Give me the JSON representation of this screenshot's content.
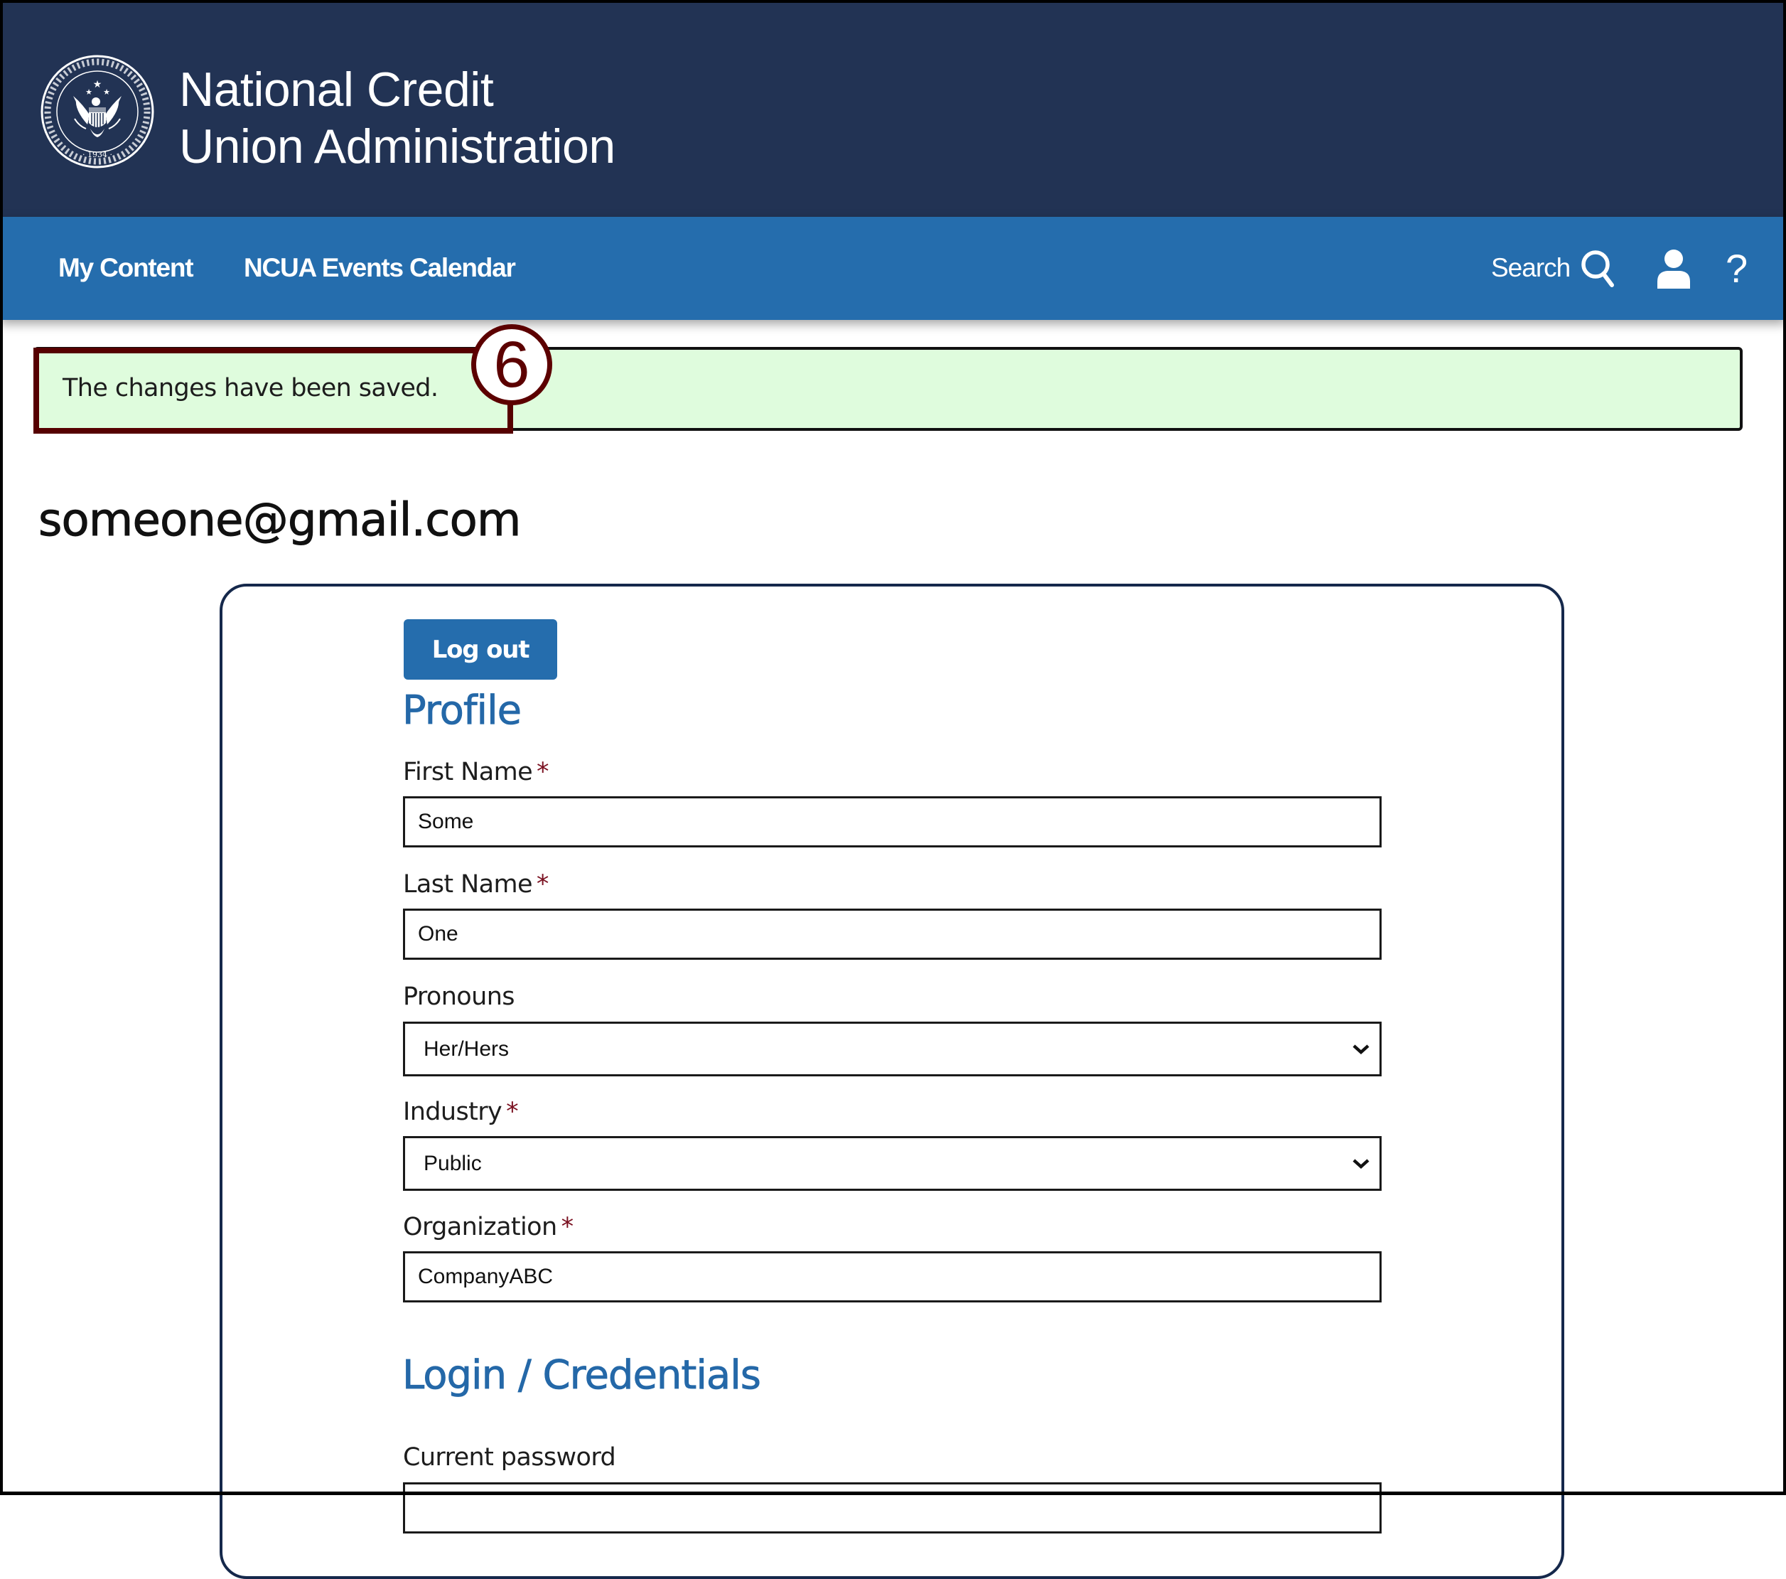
{
  "header": {
    "logo_alt": "NCUA seal",
    "title_line1": "National Credit",
    "title_line2": "Union Administration"
  },
  "nav": {
    "links": [
      {
        "label": "My Content"
      },
      {
        "label": "NCUA Events Calendar"
      }
    ],
    "search_label": "Search",
    "search_icon": "search-icon",
    "user_icon": "user-icon",
    "help_label": "?"
  },
  "alert": {
    "message": "The changes have been saved.",
    "background": "#dffcdd"
  },
  "annotation": {
    "step_number": "6",
    "color": "#5c0000"
  },
  "account": {
    "email": "someone@gmail.com"
  },
  "card": {
    "logout_label": "Log out",
    "profile_title": "Profile",
    "fields": {
      "first_name": {
        "label": "First Name",
        "required": "*",
        "value": "Some"
      },
      "last_name": {
        "label": "Last Name",
        "required": "*",
        "value": "One"
      },
      "pronouns": {
        "label": "Pronouns",
        "value": "Her/Hers"
      },
      "industry": {
        "label": "Industry",
        "required": "*",
        "value": "Public"
      },
      "organization": {
        "label": "Organization",
        "required": "*",
        "value": "CompanyABC"
      }
    },
    "login_title": "Login / Credentials",
    "current_password": {
      "label": "Current password",
      "value": ""
    }
  },
  "colors": {
    "header_bg": "#223354",
    "nav_bg": "#256dad",
    "accent": "#2468a8",
    "required": "#7a1020"
  }
}
